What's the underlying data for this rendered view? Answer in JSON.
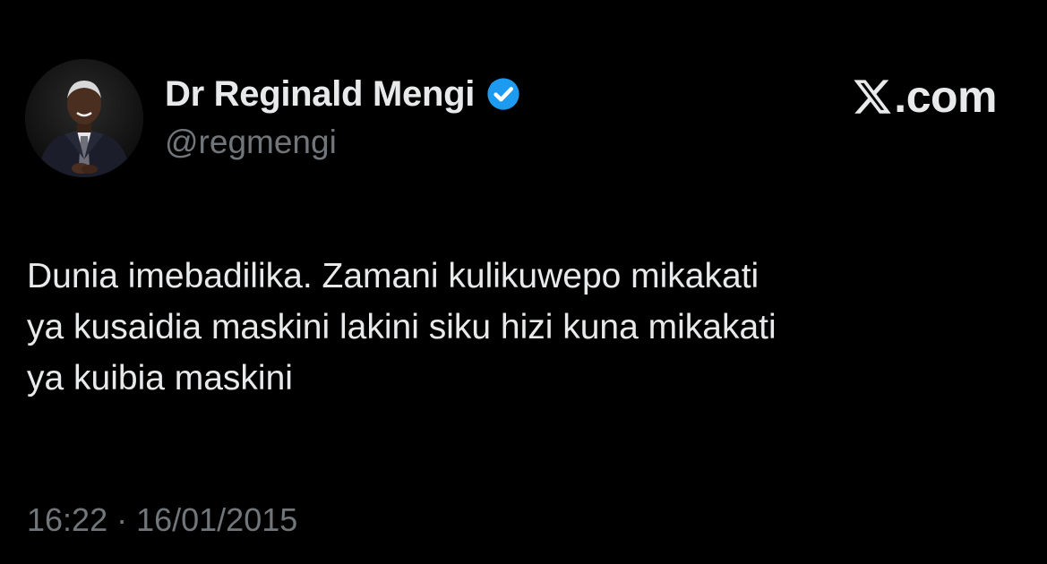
{
  "author": {
    "display_name": "Dr Reginald Mengi",
    "handle": "@regmengi",
    "verified": true,
    "verified_color": "#1d9bf0",
    "avatar_icon": "profile-photo"
  },
  "brand": {
    "text": ".com",
    "icon": "x-logo-icon"
  },
  "tweet": {
    "lines": [
      "Dunia imebadilika. Zamani kulikuwepo mikakati",
      "ya kusaidia maskini lakini siku hizi kuna mikakati",
      "ya kuibia maskini"
    ]
  },
  "meta": {
    "timestamp": "16:22 · 16/01/2015"
  },
  "colors": {
    "background": "#000000",
    "primary_text": "#e7e9ea",
    "secondary_text": "#71767b"
  }
}
